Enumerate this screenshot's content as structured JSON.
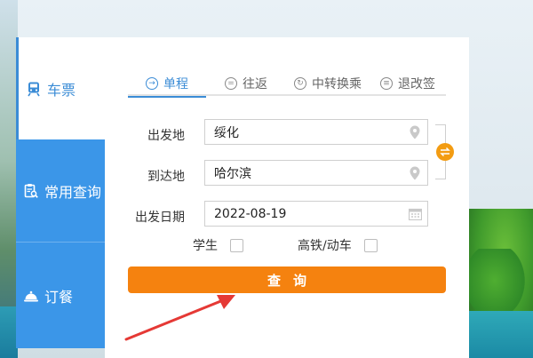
{
  "sidebar": {
    "items": [
      {
        "label": "车票",
        "icon": "train-icon"
      },
      {
        "label": "常用查询",
        "icon": "clipboard-search-icon"
      },
      {
        "label": "订餐",
        "icon": "meal-bell-icon"
      }
    ]
  },
  "tabs": [
    {
      "label": "单程",
      "icon": "single-trip-icon"
    },
    {
      "label": "往返",
      "icon": "round-trip-icon"
    },
    {
      "label": "中转换乘",
      "icon": "transfer-icon"
    },
    {
      "label": "退改签",
      "icon": "refund-change-icon"
    }
  ],
  "form": {
    "from_label": "出发地",
    "from_value": "绥化",
    "to_label": "到达地",
    "to_value": "哈尔滨",
    "date_label": "出发日期",
    "date_value": "2022-08-19",
    "student_label": "学生",
    "highspeed_label": "高铁/动车",
    "search_label": "查询"
  },
  "colors": {
    "accent_blue": "#3b8cd6",
    "sidebar_blue": "#3b96e8",
    "search_orange": "#f5820f",
    "swap_orange": "#f39c12",
    "annotation_red": "#e53935"
  }
}
